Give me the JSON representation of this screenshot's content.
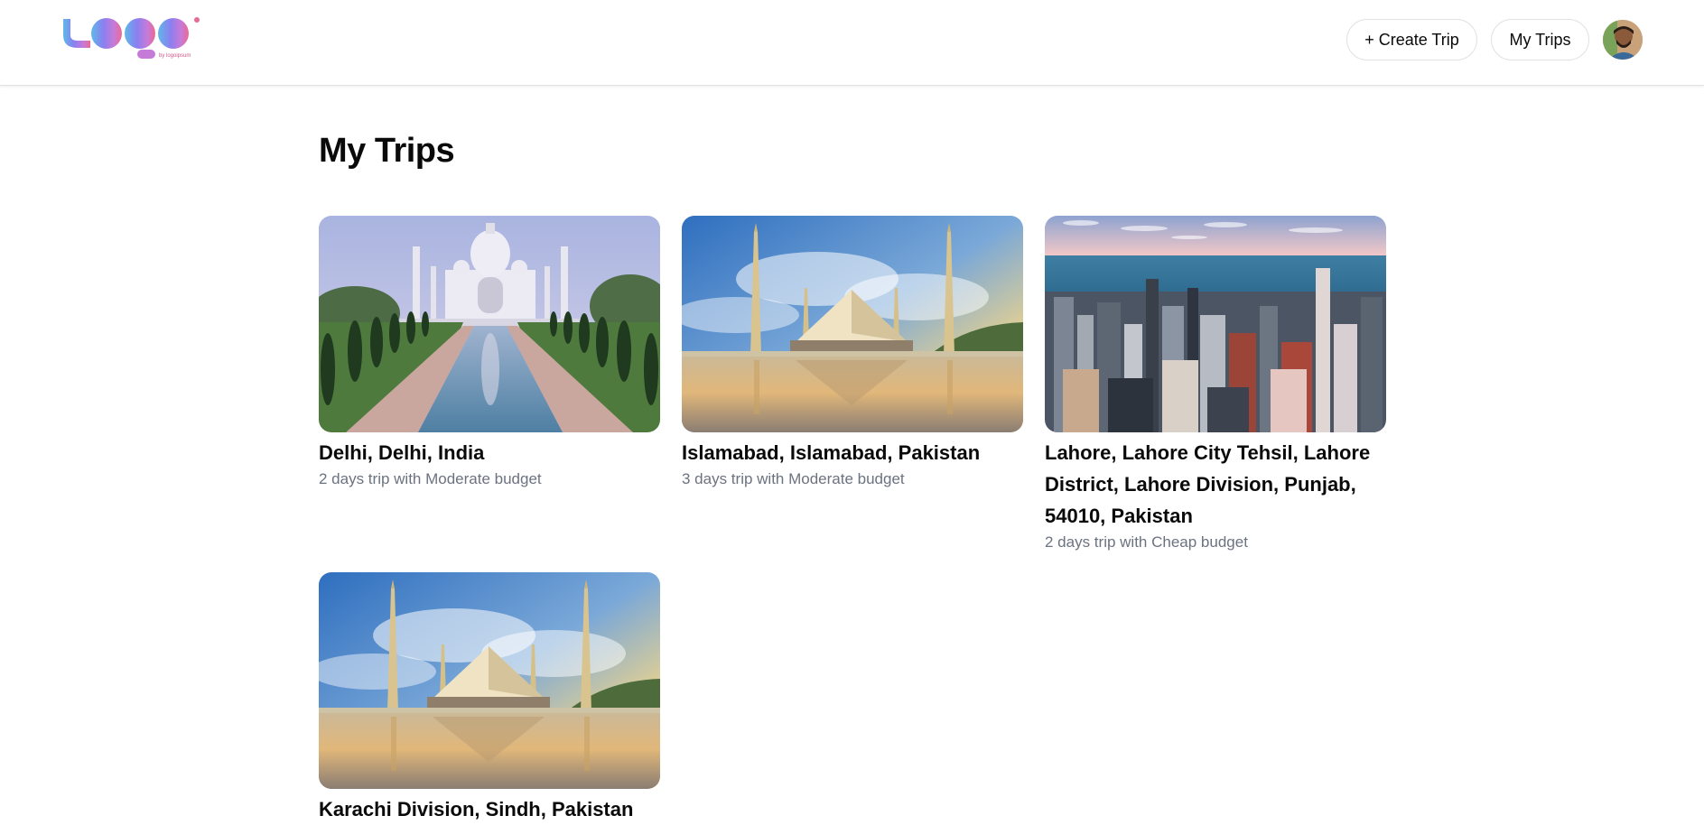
{
  "header": {
    "logo_text": "Logo",
    "logo_tagline": "by logoipsum",
    "create_trip_label": "+ Create Trip",
    "my_trips_label": "My Trips",
    "avatar_icon": "user-avatar"
  },
  "main": {
    "title": "My Trips",
    "trips": [
      {
        "location": "Delhi, Delhi, India",
        "summary": "2 days trip with Moderate budget",
        "image": "taj-mahal-photo"
      },
      {
        "location": "Islamabad, Islamabad, Pakistan",
        "summary": "3 days trip with Moderate budget",
        "image": "faisal-mosque-photo"
      },
      {
        "location": "Lahore, Lahore City Tehsil, Lahore District, Lahore Division, Punjab, 54010, Pakistan",
        "summary": "2 days trip with Cheap budget",
        "image": "city-skyline-photo"
      },
      {
        "location": "Karachi Division, Sindh, Pakistan",
        "summary": "",
        "image": "faisal-mosque-photo"
      }
    ]
  },
  "colors": {
    "logo_gradient_start": "#5fb8e8",
    "logo_gradient_mid": "#8a7ff0",
    "logo_gradient_end": "#e06a9a",
    "subtitle_gray": "#6b7280",
    "border": "#e2e2e2"
  }
}
